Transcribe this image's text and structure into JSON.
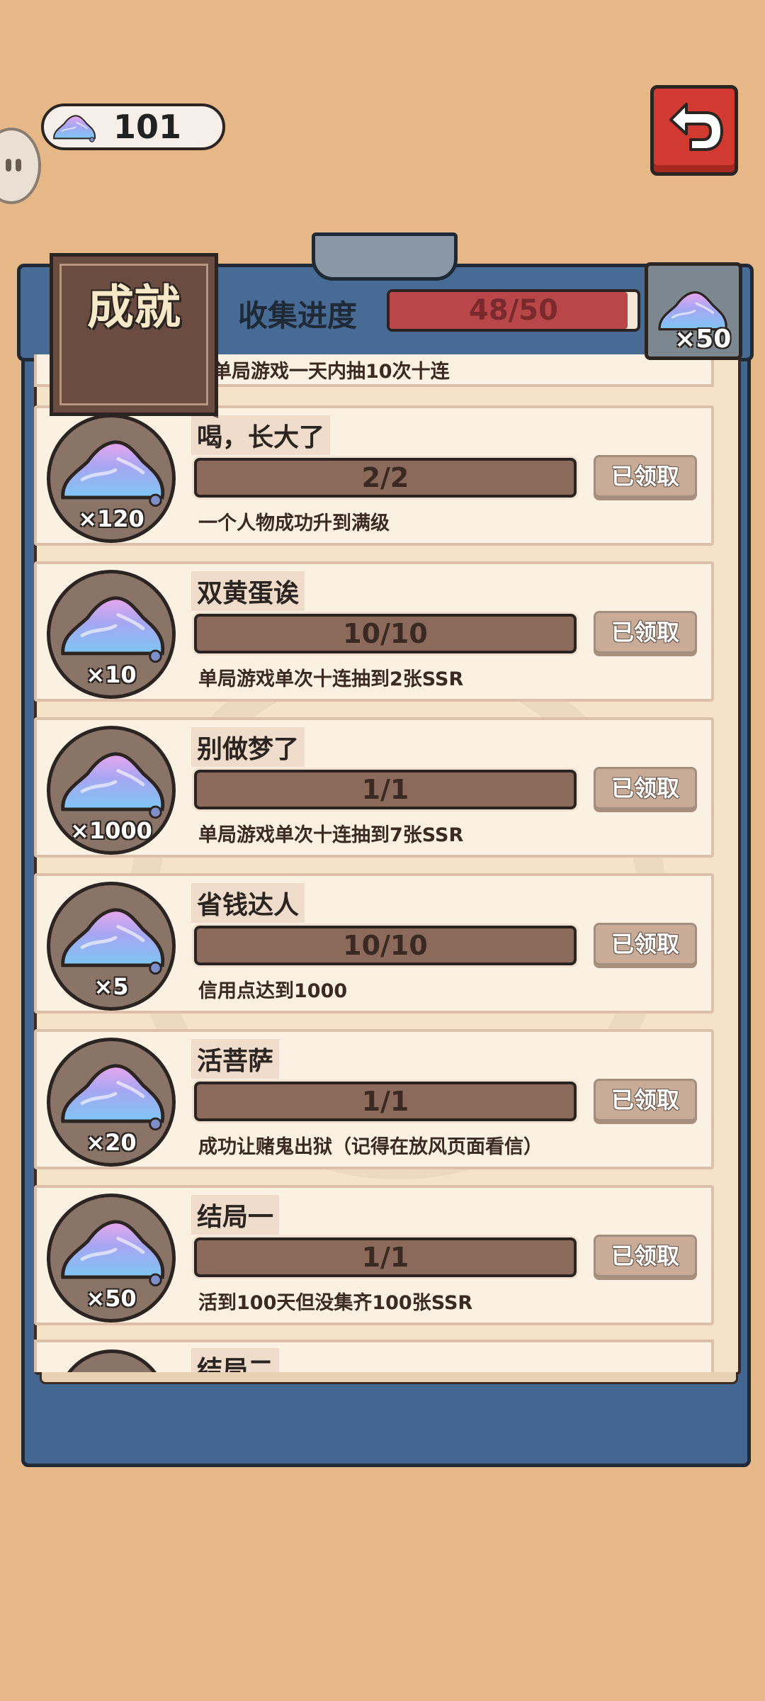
{
  "currency": {
    "icon": "gem-icon",
    "amount": "101"
  },
  "back_button": {
    "icon": "back-arrow-icon"
  },
  "header": {
    "banner_title": "成就",
    "progress_label": "收集进度",
    "progress_text": "48/50",
    "progress_value": 0.96,
    "reward_icon": "gem-icon",
    "reward_qty": "×50"
  },
  "partial_top_desc": "单局游戏一天内抽10次十连",
  "achievements": [
    {
      "title": "喝，长大了",
      "progress": "2/2",
      "button": "已领取",
      "desc": "一个人物成功升到满级",
      "reward": "×120"
    },
    {
      "title": "双黄蛋诶",
      "progress": "10/10",
      "button": "已领取",
      "desc": "单局游戏单次十连抽到2张SSR",
      "reward": "×10"
    },
    {
      "title": "别做梦了",
      "progress": "1/1",
      "button": "已领取",
      "desc": "单局游戏单次十连抽到7张SSR",
      "reward": "×1000"
    },
    {
      "title": "省钱达人",
      "progress": "10/10",
      "button": "已领取",
      "desc": "信用点达到1000",
      "reward": "×5"
    },
    {
      "title": "活菩萨",
      "progress": "1/1",
      "button": "已领取",
      "desc": "成功让赌鬼出狱（记得在放风页面看信）",
      "reward": "×20"
    },
    {
      "title": "结局一",
      "progress": "1/1",
      "button": "已领取",
      "desc": "活到100天但没集齐100张SSR",
      "reward": "×50"
    }
  ],
  "partial_bottom_title": "结局二",
  "colors": {
    "background": "#e7b887",
    "board": "#436790",
    "claimed_button": "#c9ac98",
    "progress_fill": "#b9474a"
  }
}
